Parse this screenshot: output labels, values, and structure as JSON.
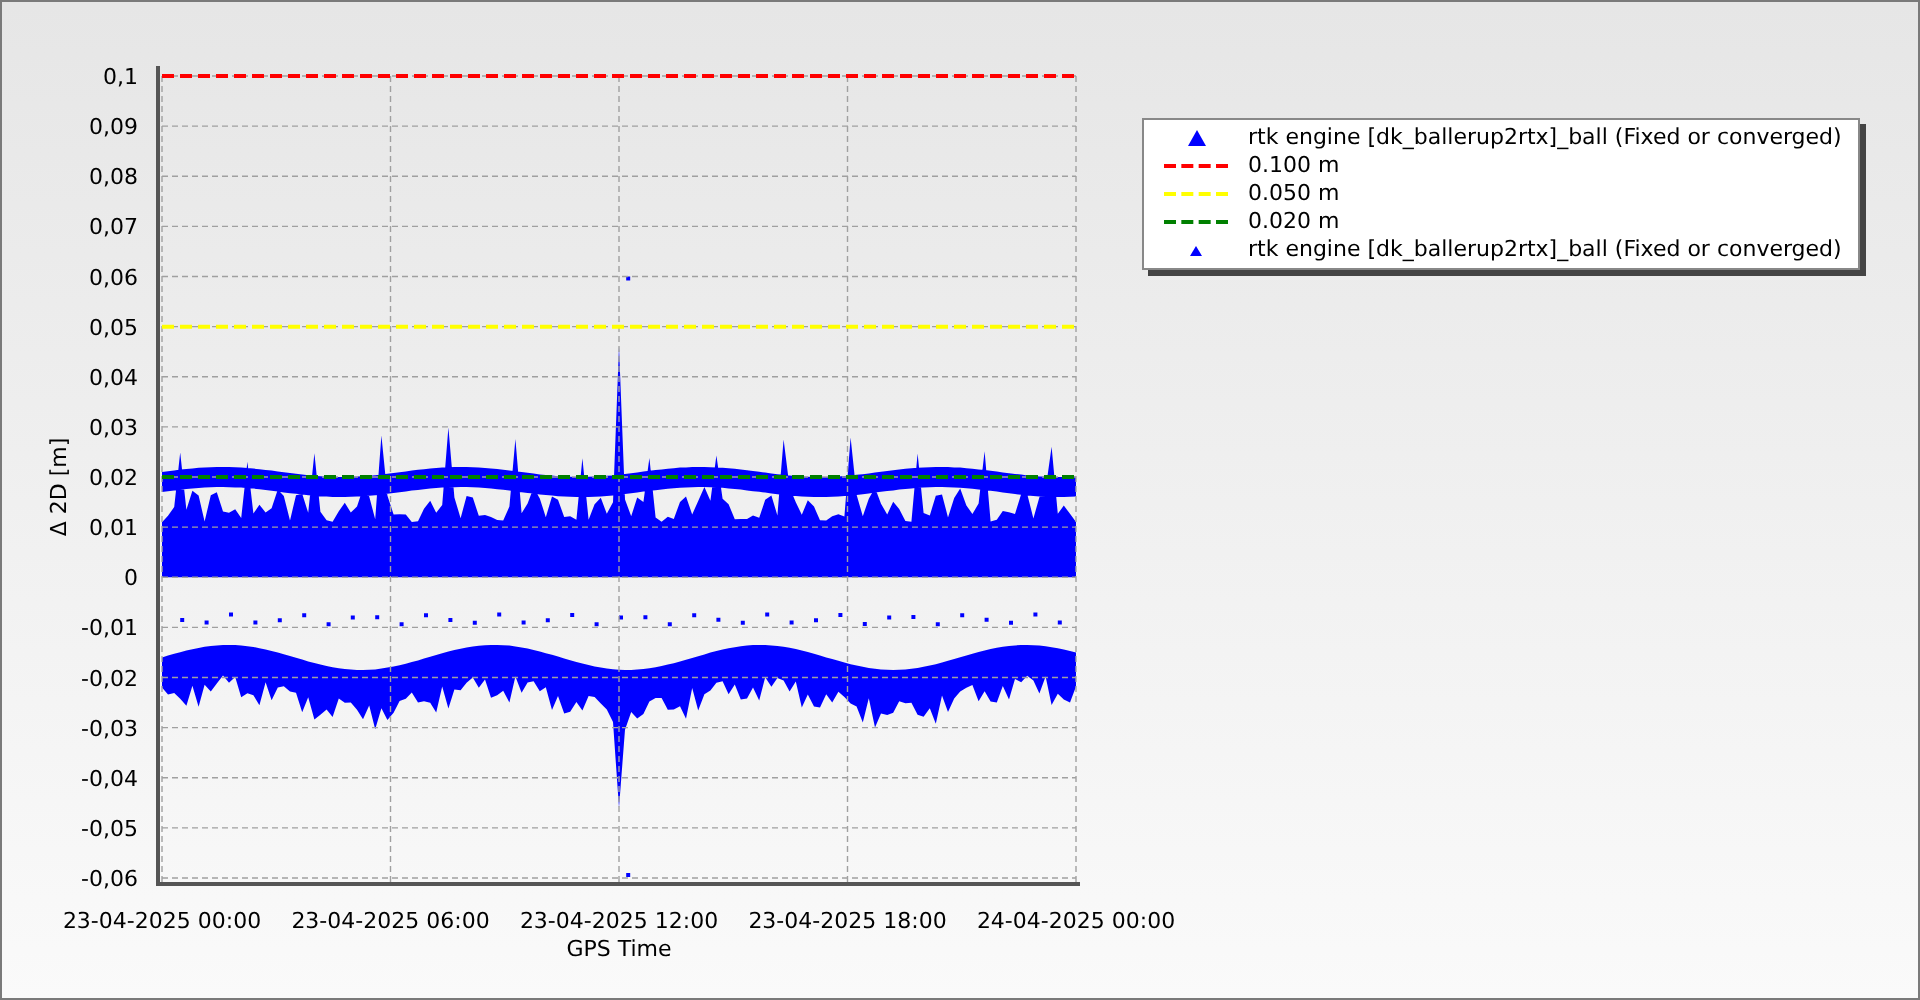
{
  "chart": {
    "chart_data": {
      "type": "line",
      "grid": true,
      "xlabel": "GPS Time",
      "ylabel": "Δ 2D [m]",
      "categories": [
        "23-04-2025 00:00",
        "23-04-2025 06:00",
        "23-04-2025 12:00",
        "23-04-2025 18:00",
        "24-04-2025 00:00"
      ],
      "ylim": [
        -0.06,
        0.1
      ],
      "yticks": [
        {
          "value": 0.1,
          "label": "0,1"
        },
        {
          "value": 0.09,
          "label": "0,09"
        },
        {
          "value": 0.08,
          "label": "0,08"
        },
        {
          "value": 0.07,
          "label": "0,07"
        },
        {
          "value": 0.06,
          "label": "0,06"
        },
        {
          "value": 0.05,
          "label": "0,05"
        },
        {
          "value": 0.04,
          "label": "0,04"
        },
        {
          "value": 0.03,
          "label": "0,03"
        },
        {
          "value": 0.02,
          "label": "0,02"
        },
        {
          "value": 0.01,
          "label": "0,01"
        },
        {
          "value": 0,
          "label": "0"
        },
        {
          "value": -0.01,
          "label": "-0,01"
        },
        {
          "value": -0.02,
          "label": "-0,02"
        },
        {
          "value": -0.03,
          "label": "-0,03"
        },
        {
          "value": -0.04,
          "label": "-0,04"
        },
        {
          "value": -0.05,
          "label": "-0,05"
        },
        {
          "value": -0.06,
          "label": "-0,06"
        }
      ],
      "series": [
        {
          "name": "0.100 m",
          "color": "#ff0000",
          "line_style": "dashed",
          "values": [
            0.1,
            0.1,
            0.1,
            0.1,
            0.1
          ]
        },
        {
          "name": "0.050 m",
          "color": "#ffff00",
          "line_style": "dashed",
          "values": [
            0.05,
            0.05,
            0.05,
            0.05,
            0.05
          ]
        },
        {
          "name": "0.020 m",
          "color": "#008000",
          "line_style": "dashed",
          "values": [
            0.02,
            0.02,
            0.02,
            0.02,
            0.02
          ]
        }
      ]
    }
  },
  "legend": {
    "first": {
      "label": "rtk engine [dk_ballerup2rtx]_ball (Fixed or converged)",
      "color": "#0000ff"
    },
    "last": {
      "label": "rtk engine [dk_ballerup2rtx]_ball (Fixed or converged)",
      "color": "#0000ff"
    }
  }
}
